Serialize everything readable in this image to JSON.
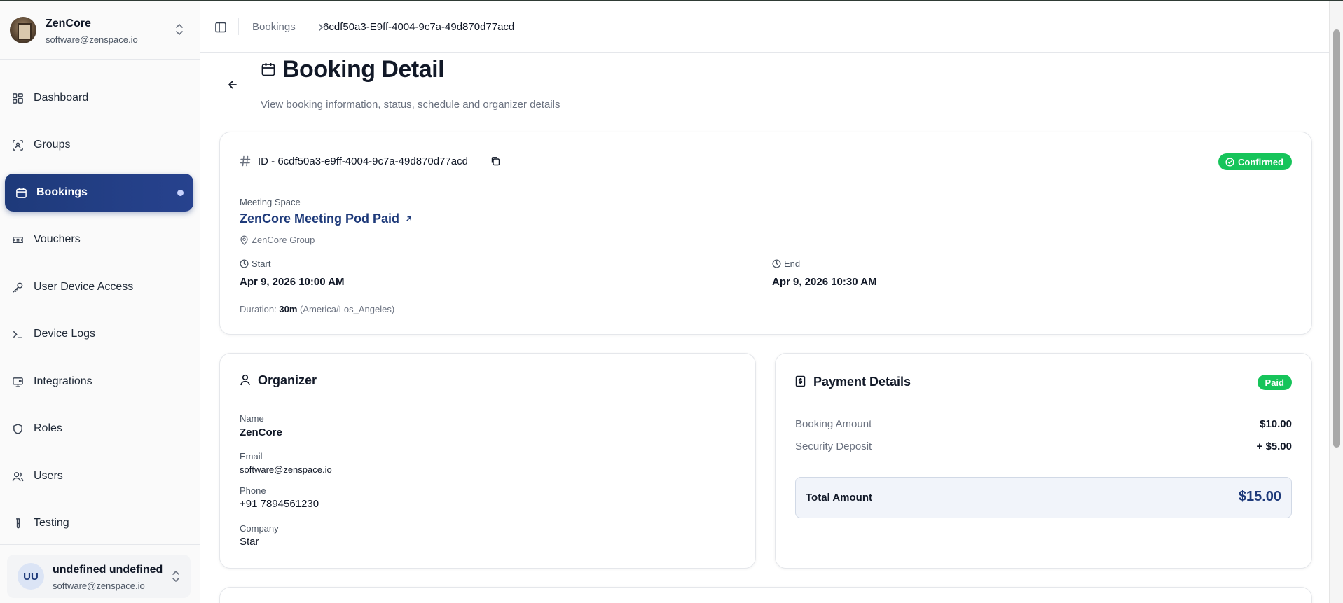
{
  "workspace": {
    "name": "ZenCore",
    "email": "software@zenspace.io"
  },
  "nav": [
    {
      "label": "Dashboard",
      "icon": "dashboard-icon"
    },
    {
      "label": "Groups",
      "icon": "groups-icon"
    },
    {
      "label": "Bookings",
      "icon": "calendar-icon",
      "active": true
    },
    {
      "label": "Vouchers",
      "icon": "ticket-icon"
    },
    {
      "label": "User Device Access",
      "icon": "key-icon"
    },
    {
      "label": "Device Logs",
      "icon": "terminal-icon"
    },
    {
      "label": "Integrations",
      "icon": "monitor-icon"
    },
    {
      "label": "Roles",
      "icon": "shield-icon"
    },
    {
      "label": "Users",
      "icon": "users-icon"
    },
    {
      "label": "Testing",
      "icon": "test-tube-icon"
    }
  ],
  "user": {
    "initials": "UU",
    "name": "undefined undefined",
    "email": "software@zenspace.io"
  },
  "breadcrumb": {
    "parent": "Bookings",
    "current": "6cdf50a3-E9ff-4004-9c7a-49d870d77acd"
  },
  "page": {
    "title": "Booking Detail",
    "subtitle": "View booking information, status, schedule and organizer details"
  },
  "booking": {
    "id_text": "ID - 6cdf50a3-e9ff-4004-9c7a-49d870d77acd",
    "status": "Confirmed",
    "meeting_space_label": "Meeting Space",
    "meeting_space_name": "ZenCore Meeting Pod Paid",
    "group": "ZenCore Group",
    "start_label": "Start",
    "start_value": "Apr 9, 2026 10:00 AM",
    "end_label": "End",
    "end_value": "Apr 9, 2026 10:30 AM",
    "duration_label": "Duration:",
    "duration_value": "30m",
    "timezone": "(America/Los_Angeles)"
  },
  "organizer": {
    "title": "Organizer",
    "name_label": "Name",
    "name": "ZenCore",
    "email_label": "Email",
    "email": "software@zenspace.io",
    "phone_label": "Phone",
    "phone": "+91 7894561230",
    "company_label": "Company",
    "company": "Star"
  },
  "payment": {
    "title": "Payment Details",
    "status": "Paid",
    "booking_amount_label": "Booking Amount",
    "booking_amount": "$10.00",
    "deposit_label": "Security Deposit",
    "deposit": "+ $5.00",
    "total_label": "Total Amount",
    "total": "$15.00"
  },
  "colors": {
    "accent": "#1e3a7a",
    "success": "#16c45a"
  }
}
